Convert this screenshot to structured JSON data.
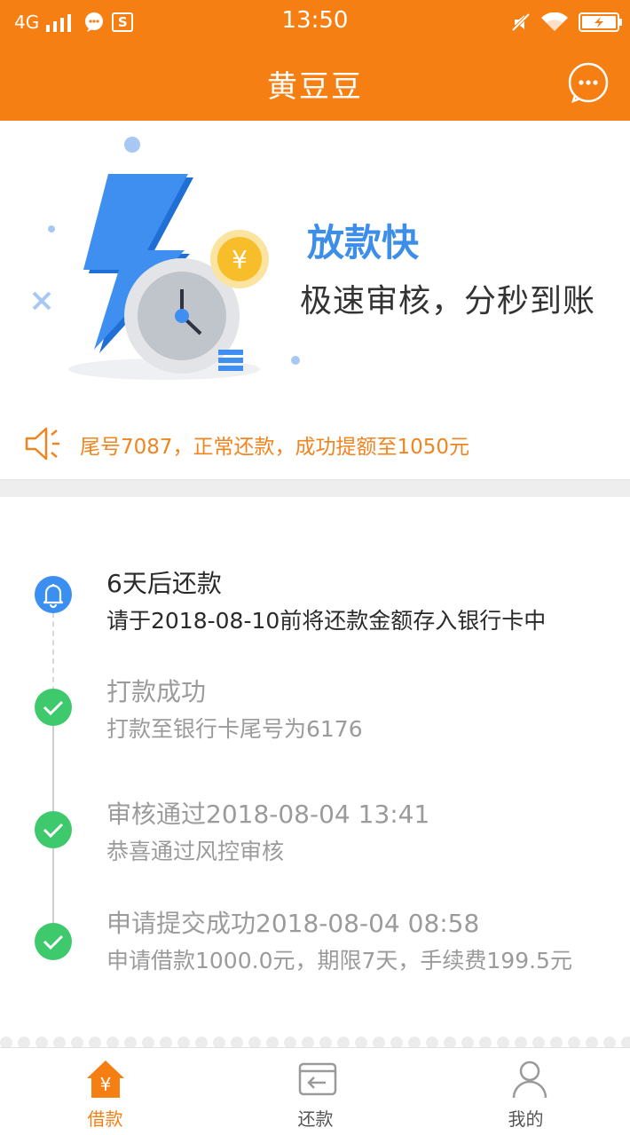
{
  "status_bar": {
    "network": "4G",
    "time": "13:50",
    "sim_icon_letter": "S"
  },
  "nav": {
    "title": "黄豆豆"
  },
  "banner": {
    "title": "放款快",
    "subtitle": "极速审核，分秒到账",
    "coin_symbol": "¥"
  },
  "notice": {
    "text": "尾号7087，正常还款，成功提额至1050元"
  },
  "timeline": {
    "steps": [
      {
        "title": "6天后还款",
        "desc": "请于2018-08-10前将还款金额存入银行卡中",
        "state": "active",
        "icon": "bell-icon"
      },
      {
        "title": "打款成功",
        "desc": "打款至银行卡尾号为6176",
        "state": "done",
        "icon": "check-icon"
      },
      {
        "title": "审核通过2018-08-04 13:41",
        "desc": "恭喜通过风控审核",
        "state": "done",
        "icon": "check-icon"
      },
      {
        "title": "申请提交成功2018-08-04 08:58",
        "desc": "申请借款1000.0元，期限7天，手续费199.5元",
        "state": "done",
        "icon": "check-icon"
      }
    ]
  },
  "tabs": [
    {
      "label": "借款",
      "icon": "borrow-home-icon",
      "icon_symbol": "¥",
      "active": true
    },
    {
      "label": "还款",
      "icon": "repay-card-icon",
      "active": false
    },
    {
      "label": "我的",
      "icon": "profile-icon",
      "active": false
    }
  ],
  "colors": {
    "brand_orange": "#f57f13",
    "blue": "#3b8ff0",
    "green": "#3ec96c",
    "notice_orange": "#f08520"
  }
}
